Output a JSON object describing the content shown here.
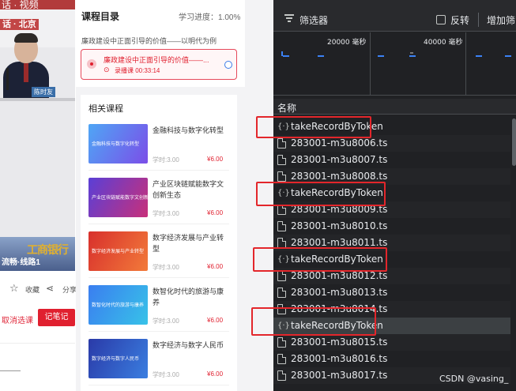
{
  "video": {
    "title_fragment": "话 · 视频",
    "subtitle": "话 · 北京",
    "nameplate": "陈时友",
    "logo_text": "工商银行",
    "course_overlay": "流畅·线路1",
    "actions": {
      "favorite_label": "收藏",
      "share_label": "分享"
    },
    "cancel_enroll_label": "取消选课",
    "note_button_label": "记笔记"
  },
  "outline": {
    "title": "课程目录",
    "progress": "学习进度：1.00%",
    "lesson_title": "廉政建设中正面引导的价值——以明代为例",
    "active_lesson": {
      "title": "廉政建设中正面引导的价值——...",
      "meta": "录播课 00:33:14"
    }
  },
  "related": {
    "title": "相关课程",
    "items": [
      {
        "name": "金融科技与数字化转型",
        "thumb_text": "金融科技与数字化转型",
        "hours": "学时:3.00",
        "price": "¥6.00",
        "c1": "#4fa6f5",
        "c2": "#7b4ee8"
      },
      {
        "name": "产业区块链赋能数字文创新生态",
        "thumb_text": "产业区块链赋能数字文创新生态",
        "hours": "学时:3.00",
        "price": "¥6.00",
        "c1": "#5a3fd6",
        "c2": "#c8307a"
      },
      {
        "name": "数字经济发展与产业转型",
        "thumb_text": "数字经济发展与产业转型",
        "hours": "学时:3.00",
        "price": "¥6.00",
        "c1": "#d8302c",
        "c2": "#f27a3a"
      },
      {
        "name": "数智化时代的旅游与康养",
        "thumb_text": "数智化时代的旅游与康养",
        "hours": "学时:3.00",
        "price": "¥6.00",
        "c1": "#3a7ef0",
        "c2": "#38c2e8"
      },
      {
        "name": "数字经济与数字人民币",
        "thumb_text": "数字经济与数字人民币",
        "hours": "学时:3.00",
        "price": "¥6.00",
        "c1": "#2a3aa8",
        "c2": "#3a7ee0"
      }
    ]
  },
  "devtools": {
    "filter_label": "筛选器",
    "invert_label": "反转",
    "more_label": "增加筛",
    "timeline_ticks": [
      "20000 毫秒",
      "40000 毫秒"
    ],
    "name_column": "名称",
    "rows": [
      {
        "name": "takeRecordByToken",
        "type": "xhr"
      },
      {
        "name": "283001-m3u8006.ts",
        "type": "doc"
      },
      {
        "name": "283001-m3u8007.ts",
        "type": "doc"
      },
      {
        "name": "283001-m3u8008.ts",
        "type": "doc"
      },
      {
        "name": "takeRecordByToken",
        "type": "xhr"
      },
      {
        "name": "283001-m3u8009.ts",
        "type": "doc"
      },
      {
        "name": "283001-m3u8010.ts",
        "type": "doc"
      },
      {
        "name": "283001-m3u8011.ts",
        "type": "doc"
      },
      {
        "name": "takeRecordByToken",
        "type": "xhr"
      },
      {
        "name": "283001-m3u8012.ts",
        "type": "doc"
      },
      {
        "name": "283001-m3u8013.ts",
        "type": "doc"
      },
      {
        "name": "283001-m3u8014.ts",
        "type": "doc"
      },
      {
        "name": "takeRecordByToken",
        "type": "xhr"
      },
      {
        "name": "283001-m3u8015.ts",
        "type": "doc"
      },
      {
        "name": "283001-m3u8016.ts",
        "type": "doc"
      },
      {
        "name": "283001-m3u8017.ts",
        "type": "doc"
      }
    ],
    "xhr_icon": "{·}",
    "highlight_color": "#e3262b"
  },
  "watermark": "CSDN @vasing_"
}
